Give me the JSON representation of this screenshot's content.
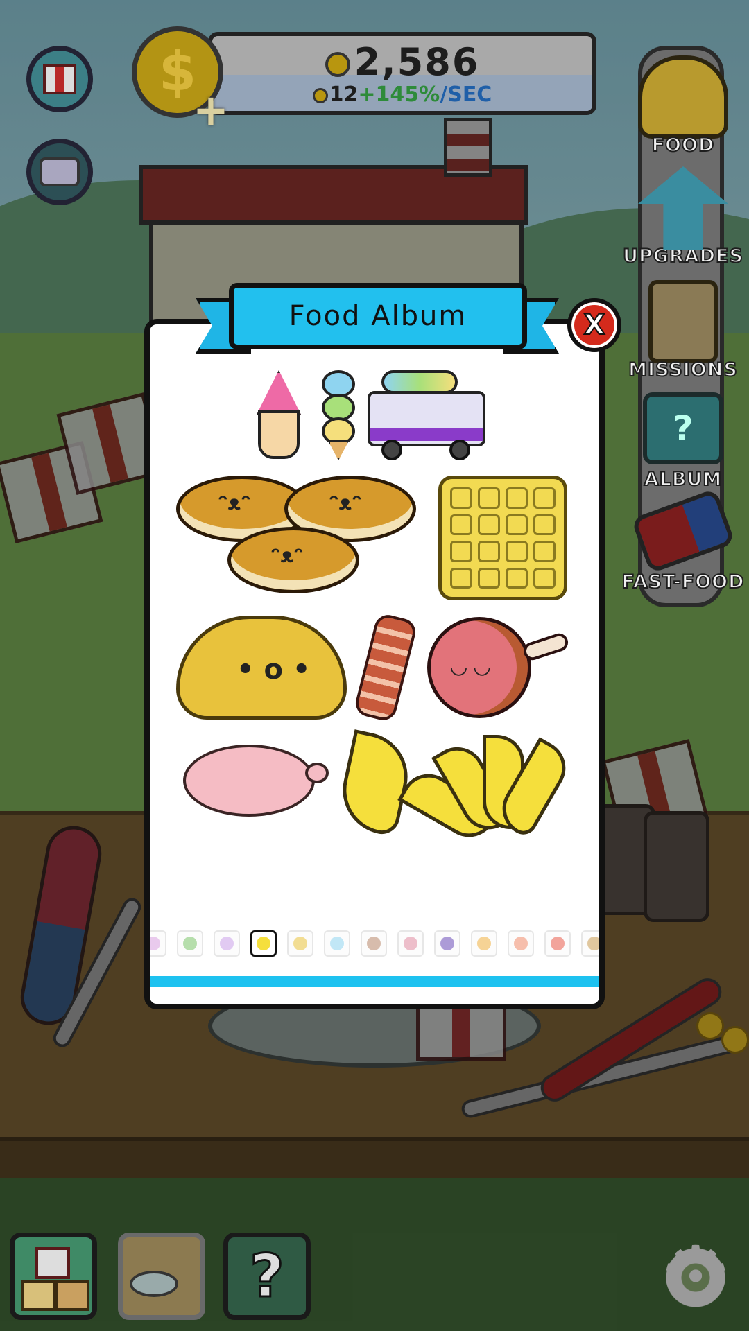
{
  "hud": {
    "coin_total": "2,586",
    "rate_value": "12",
    "rate_bonus": "+145%",
    "rate_unit": "/SEC",
    "coin_symbol": "$",
    "plus_symbol": "+"
  },
  "side_menu": {
    "items": [
      {
        "label": "FOOD",
        "icon": "taco-icon"
      },
      {
        "label": "UPGRADES",
        "icon": "upgrade-arrow-icon"
      },
      {
        "label": "MISSIONS",
        "icon": "clipboard-icon"
      },
      {
        "label": "ALBUM",
        "icon": "album-book-icon"
      },
      {
        "label": "FAST-FOOD",
        "icon": "fast-food-truck-icon"
      }
    ]
  },
  "album": {
    "title": "Food Album",
    "close_label": "X",
    "album_help_glyph": "?",
    "foods": [
      {
        "name": "ice-cream-cone",
        "color": "#ee6aa6"
      },
      {
        "name": "triple-scoop-ice-cream",
        "color": "#8fd4f0"
      },
      {
        "name": "ice-cream-truck",
        "color": "#e4e2f4"
      },
      {
        "name": "pancakes",
        "color": "#d69a2c"
      },
      {
        "name": "waffle",
        "color": "#f2da52"
      },
      {
        "name": "croissant",
        "color": "#e8c23c"
      },
      {
        "name": "bacon",
        "color": "#c85a3c"
      },
      {
        "name": "ham",
        "color": "#e2737a"
      },
      {
        "name": "pig",
        "color": "#f5bcc4"
      },
      {
        "name": "banana",
        "color": "#f5df3c"
      },
      {
        "name": "banana-bunch",
        "color": "#f5df3c"
      }
    ],
    "page_thumbnails": [
      {
        "color": "#d8a0e0",
        "active": false
      },
      {
        "color": "#7cc46a",
        "active": false
      },
      {
        "color": "#c9a0e8",
        "active": false
      },
      {
        "color": "#f5df3c",
        "active": true
      },
      {
        "color": "#e8c23c",
        "active": false
      },
      {
        "color": "#8fd4f0",
        "active": false
      },
      {
        "color": "#b8866a",
        "active": false
      },
      {
        "color": "#e08aa0",
        "active": false
      },
      {
        "color": "#6a4ab8",
        "active": false
      },
      {
        "color": "#f0b040",
        "active": false
      },
      {
        "color": "#f08a6a",
        "active": false
      },
      {
        "color": "#e85a4a",
        "active": false
      },
      {
        "color": "#c89a50",
        "active": false
      }
    ]
  },
  "bottom_bar": {
    "mystery_glyph": "?",
    "settings_glyph": "⚙"
  },
  "colors": {
    "accent_blue": "#22c0ee",
    "close_red": "#d42a1c",
    "rate_green": "#2e8b3a",
    "rate_blue": "#1f5fa8"
  }
}
